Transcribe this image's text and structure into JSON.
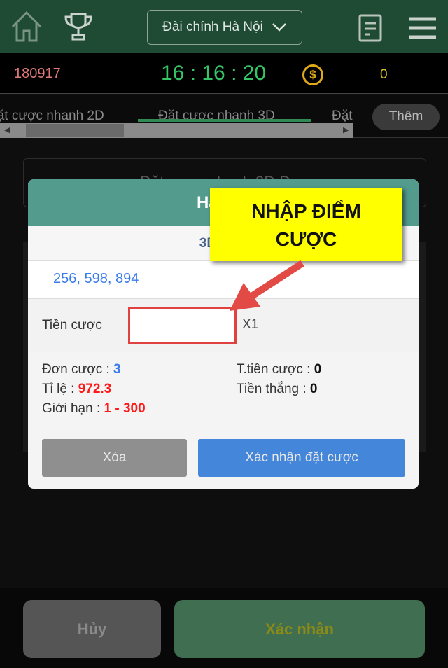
{
  "header": {
    "station": "Đài chính Hà Nội",
    "icons": [
      "home-icon",
      "trophy-icon",
      "chevron-down-icon",
      "document-icon",
      "menu-icon"
    ]
  },
  "info": {
    "draw_id": "180917",
    "clock": "16 : 16 : 20",
    "balance": "0",
    "coin_icon": "$"
  },
  "tabs": {
    "items": [
      "Đặt cược nhanh 2D",
      "Đặt cược nhanh 3D",
      "Đặt"
    ],
    "active": 1,
    "more": "Thêm"
  },
  "background": {
    "card_title": "Đặt cược nhanh 3D Đơn"
  },
  "modal": {
    "title": "Hà Nội",
    "subtitle": "3D Đơn",
    "numbers": "256, 598, 894",
    "bet_label": "Tiền cược",
    "bet_value": "",
    "multiplier": "X1",
    "stats": {
      "orders_label": "Đơn cược :",
      "orders": "3",
      "rate_label": "Tỉ lệ :",
      "rate": "972.3",
      "limit_label": "Giới hạn :",
      "limit": "1 - 300",
      "total_label": "T.tiền cược :",
      "total": "0",
      "win_label": "Tiền thắng :",
      "win": "0"
    },
    "clear": "Xóa",
    "confirm": "Xác nhận đặt cược"
  },
  "annotation": {
    "text_line1": "NHẬP ĐIỂM",
    "text_line2": "CƯỢC"
  },
  "footer": {
    "cancel": "Hủy",
    "confirm": "Xác nhận"
  },
  "colors": {
    "header": "#1f4a33",
    "modal_header": "#529b8d",
    "confirm_blue": "#4486da",
    "accent_red": "#ff1a1a",
    "highlight": "#ffff00"
  }
}
